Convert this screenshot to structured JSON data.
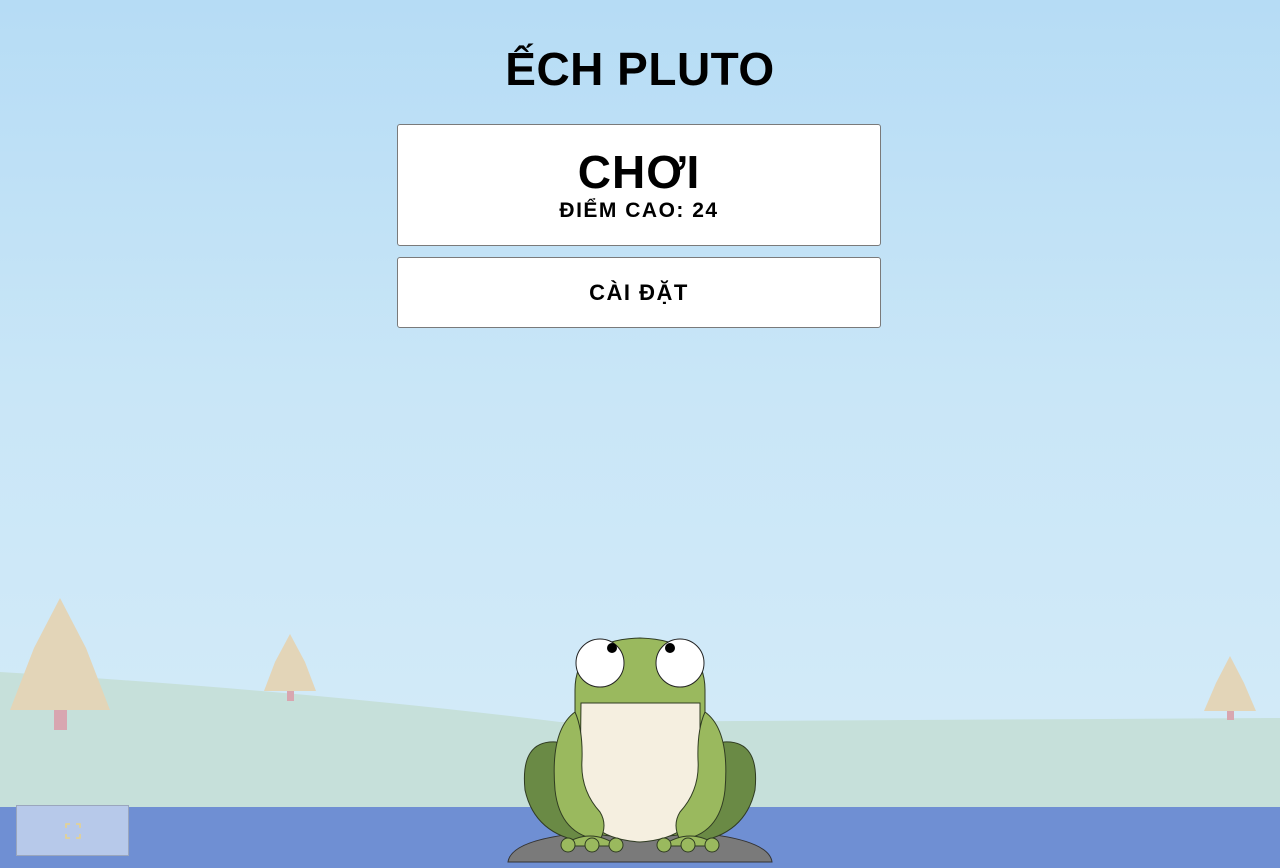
{
  "game": {
    "title": "ẾCH PLUTO"
  },
  "menu": {
    "play_label": "CHƠI",
    "highscore_text": "ĐIỂM CAO: 24",
    "settings_label": "CÀI ĐẶT"
  },
  "controls": {
    "fullscreen_icon": "expand-icon"
  },
  "colors": {
    "sky": "#b6dcf5",
    "hill": "#c6e0da",
    "water": "#6f8fd3",
    "frog_green": "#9ab95e",
    "frog_dark_green": "#6a8a45",
    "frog_belly": "#f5efe0",
    "rock": "#7a7a7a",
    "tree": "#e3d5b8",
    "tree_trunk": "#d8a6b0"
  }
}
